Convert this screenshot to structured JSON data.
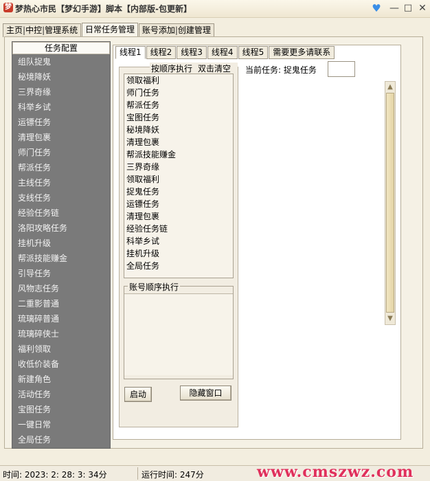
{
  "window": {
    "title": "梦热心市民【梦幻手游】脚本【内部版-包更新】"
  },
  "main_tabs": [
    {
      "label": "主页"
    },
    {
      "label": "中控"
    },
    {
      "label": "管理系统"
    },
    {
      "label": "日常任务管理"
    },
    {
      "label": "账号添加"
    },
    {
      "label": "创建管理"
    }
  ],
  "sidebar": {
    "header": "任务配置",
    "items": [
      "组队捉鬼",
      "秘境降妖",
      "三界奇缘",
      "科举乡试",
      "运镖任务",
      "清理包裹",
      "师门任务",
      "帮派任务",
      "主线任务",
      "支线任务",
      "经验任务链",
      "洛阳攻略任务",
      "挂机升级",
      "帮派技能赚金",
      "引导任务",
      "风物志任务",
      "二重影普通",
      "琉璃碎普通",
      "琉璃碎侠士",
      "福利领取",
      "收低价装备",
      "新建角色",
      "活动任务",
      "宝图任务",
      "一键日常",
      "全局任务"
    ]
  },
  "thread_tabs": [
    "线程1",
    "线程2",
    "线程3",
    "线程4",
    "线程5",
    "需要更多请联系"
  ],
  "order_panel": {
    "header_left": "按顺序执行",
    "header_right": "双击清空",
    "tasks": [
      "领取福利",
      "师门任务",
      "帮派任务",
      "宝图任务",
      "秘境降妖",
      "清理包裹",
      "帮派技能赚金",
      "三界奇缘",
      "领取福利",
      "捉鬼任务",
      "运镖任务",
      "清理包裹",
      "经验任务链",
      "科举乡试",
      "挂机升级",
      "全局任务"
    ],
    "account_legend": "账号顺序执行"
  },
  "buttons": {
    "start": "启动",
    "hide": "隐藏窗口"
  },
  "current_task": {
    "label": "当前任务: 捉鬼任务",
    "value": ""
  },
  "status": {
    "time": "时间: 2023: 2: 28: 3: 34分",
    "runtime": "运行时间: 247分"
  },
  "watermark": "www.cmszwz.com",
  "colors": {
    "sidebar_bg": "#7a7a7a",
    "watermark": "#e0305c"
  }
}
